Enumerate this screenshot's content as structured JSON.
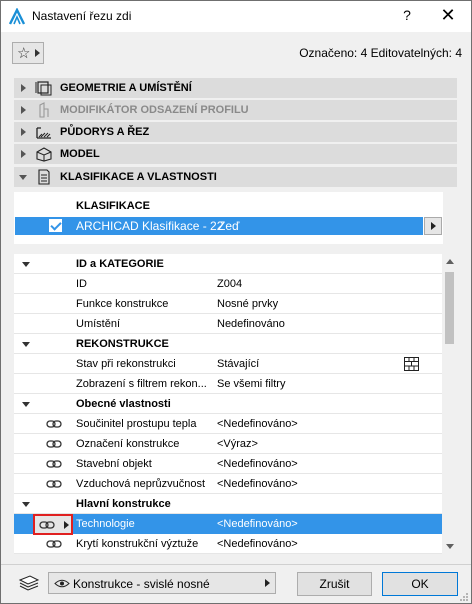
{
  "window": {
    "title": "Nastavení řezu zdi",
    "help_glyph": "?",
    "close_glyph": "✕"
  },
  "toolbar": {
    "selection_info": "Označeno: 4 Editovatelných: 4"
  },
  "panels": [
    {
      "label": "GEOMETRIE A UMÍSTĚNÍ",
      "icon": "geometry-icon"
    },
    {
      "label": "MODIFIKÁTOR ODSAZENÍ PROFILU",
      "icon": "profile-offset-icon"
    },
    {
      "label": "PŮDORYS A ŘEZ",
      "icon": "floorplan-section-icon"
    },
    {
      "label": "MODEL",
      "icon": "model-icon"
    },
    {
      "label": "KLASIFIKACE A VLASTNOSTI",
      "icon": "classification-icon"
    }
  ],
  "classification": {
    "header": "KLASIFIKACE",
    "row": {
      "system": "ARCHICAD Klasifikace - 22",
      "value": "Zeď"
    }
  },
  "properties": {
    "rows": [
      {
        "type": "group",
        "label": "ID a KATEGORIE"
      },
      {
        "type": "item",
        "label": "ID",
        "value": "Z004"
      },
      {
        "type": "item",
        "label": "Funkce konstrukce",
        "value": "Nosné prvky"
      },
      {
        "type": "item",
        "label": "Umístění",
        "value": "Nedefinováno"
      },
      {
        "type": "group",
        "label": "REKONSTRUKCE"
      },
      {
        "type": "item",
        "label": "Stav při rekonstrukci",
        "value": "Stávající"
      },
      {
        "type": "item",
        "label": "Zobrazení s filtrem rekon...",
        "value": "Se všemi filtry"
      },
      {
        "type": "group",
        "label": "Obecné vlastnosti"
      },
      {
        "type": "linked",
        "label": "Součinitel prostupu tepla",
        "value": "<Nedefinováno>"
      },
      {
        "type": "linked",
        "label": "Označení konstrukce",
        "value": "<Výraz>"
      },
      {
        "type": "linked",
        "label": "Stavební objekt",
        "value": "<Nedefinováno>"
      },
      {
        "type": "linked",
        "label": "Vzduchová neprůzvučnost",
        "value": "<Nedefinováno>"
      },
      {
        "type": "group",
        "label": "Hlavní konstrukce"
      },
      {
        "type": "selected",
        "label": "Technologie",
        "value": "<Nedefinováno>"
      },
      {
        "type": "linked",
        "label": "Krytí konstrukční výztuže",
        "value": "<Nedefinováno>"
      }
    ]
  },
  "bottom": {
    "layer": "Konstrukce - svislé nosné",
    "cancel_label": "Zrušit",
    "ok_label": "OK"
  },
  "colors": {
    "selection": "#3394e8",
    "highlight_box": "#e02020",
    "panel_bg": "#dcdcdc"
  }
}
